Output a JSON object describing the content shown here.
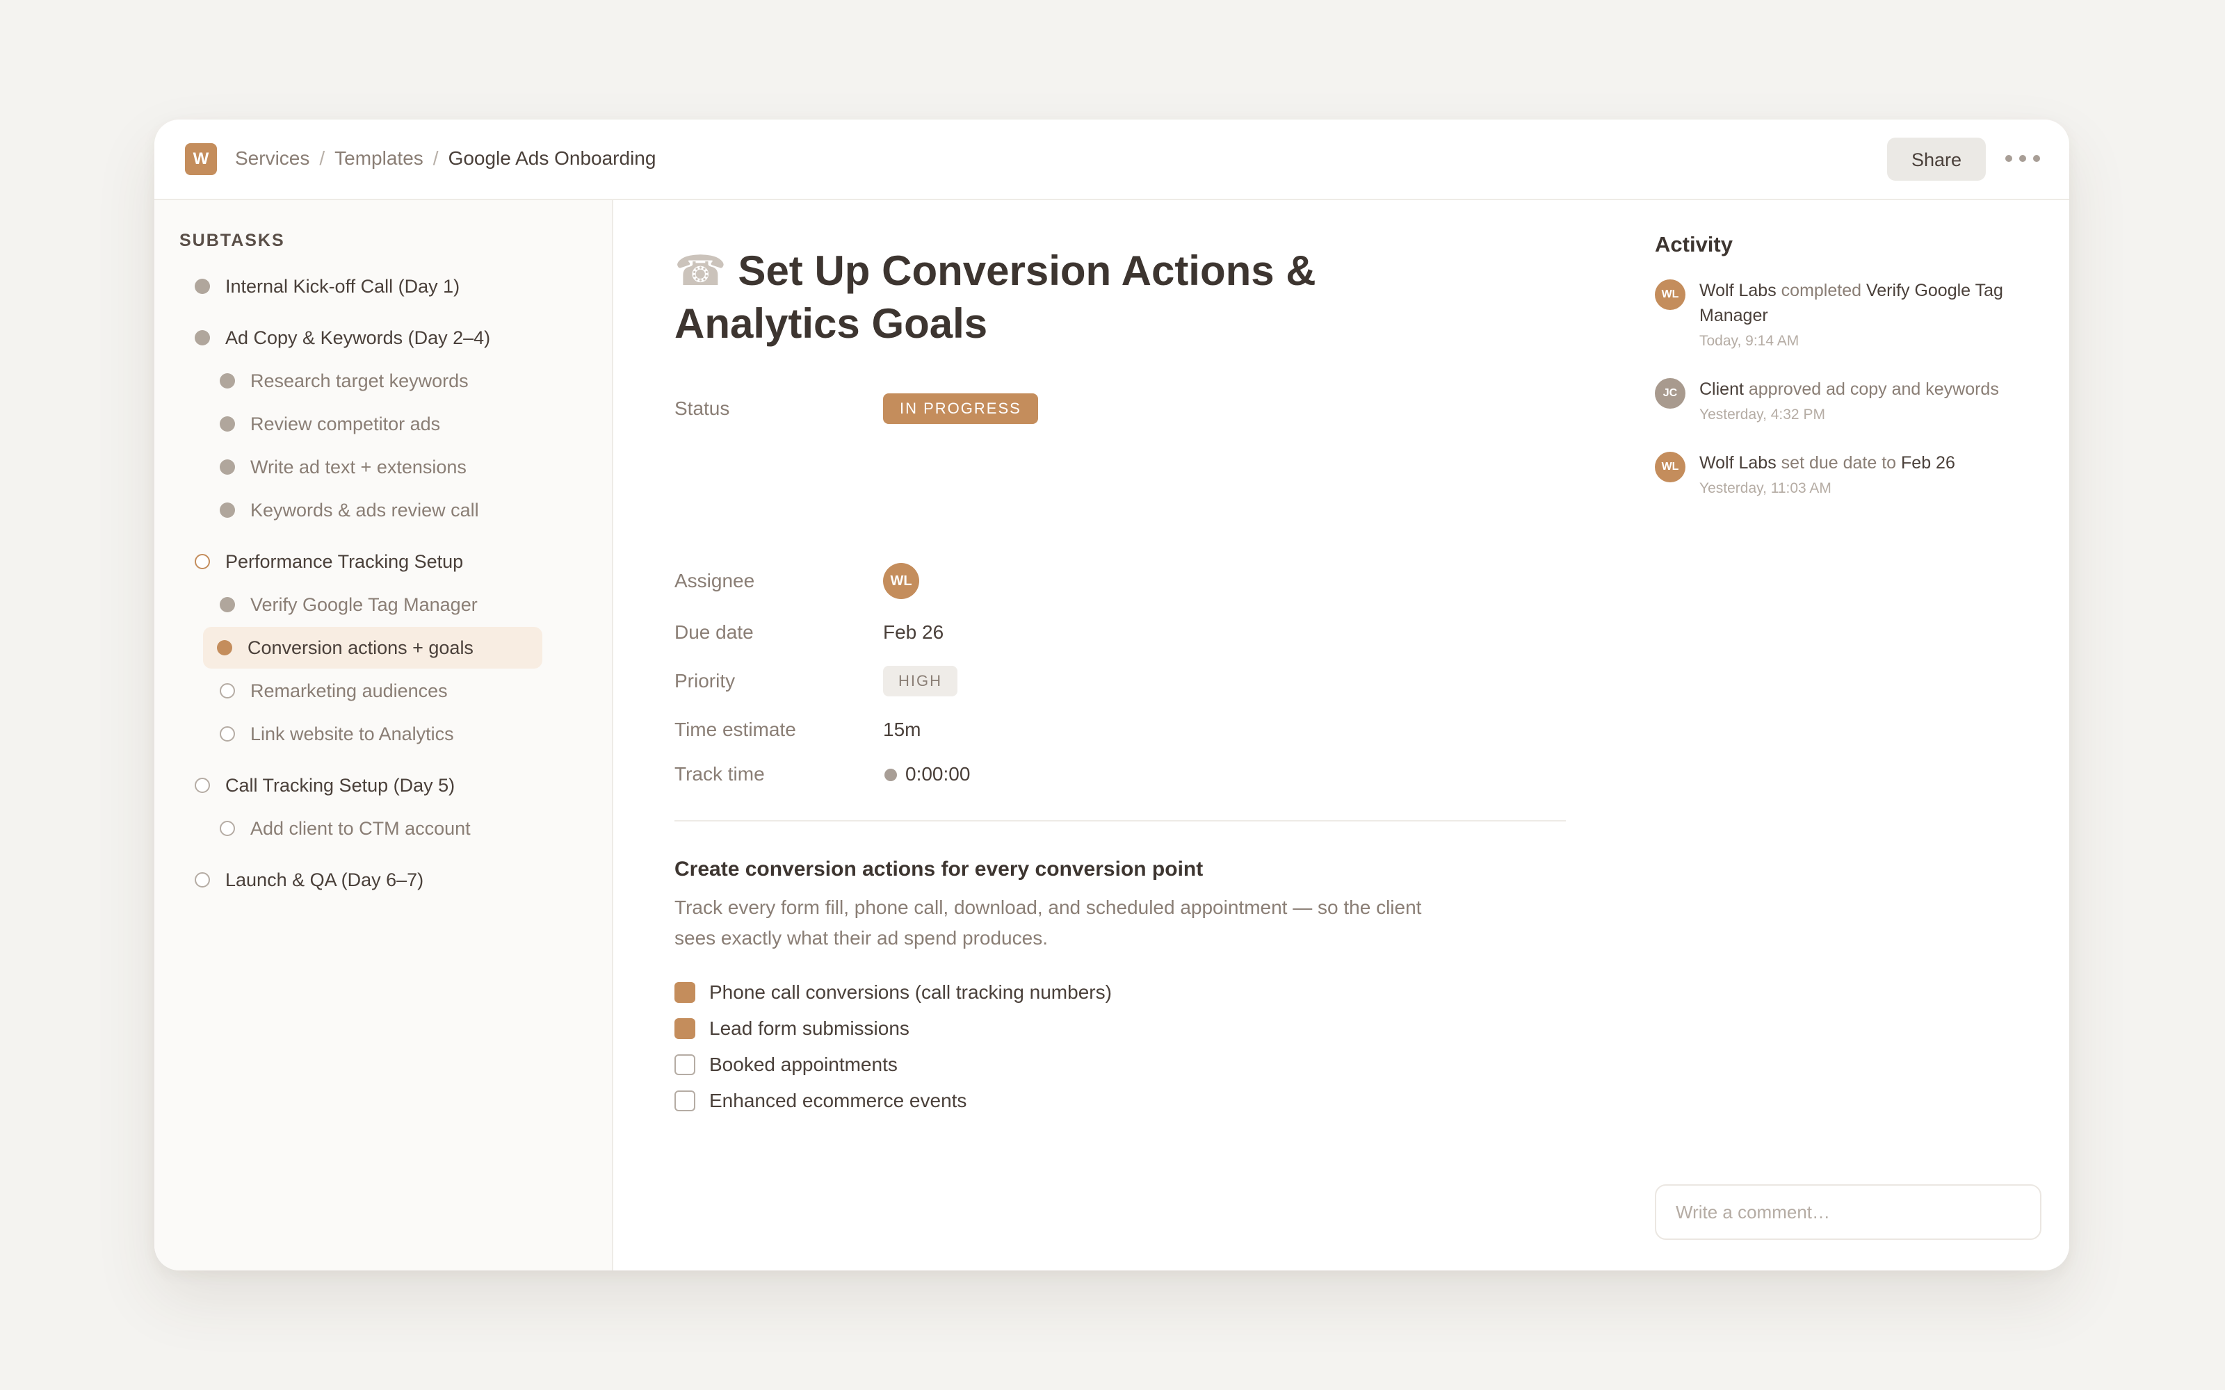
{
  "header": {
    "logo_letter": "W",
    "breadcrumb": [
      "Services",
      "Templates",
      "Google Ads Onboarding"
    ],
    "share_label": "Share",
    "more_icon": "more-horizontal-icon"
  },
  "sidebar": {
    "heading": "SUBTASKS",
    "items": [
      {
        "label": "Internal Kick-off Call (Day 1)",
        "level": 0,
        "state": "done"
      },
      {
        "label": "Ad Copy & Keywords (Day 2–4)",
        "level": 0,
        "state": "done"
      },
      {
        "label": "Research target keywords",
        "level": 1,
        "state": "done"
      },
      {
        "label": "Review competitor ads",
        "level": 1,
        "state": "done"
      },
      {
        "label": "Write ad text + extensions",
        "level": 1,
        "state": "done"
      },
      {
        "label": "Keywords & ads review call",
        "level": 1,
        "state": "done"
      },
      {
        "label": "Performance Tracking Setup",
        "level": 0,
        "state": "in-progress"
      },
      {
        "label": "Verify Google Tag Manager",
        "level": 1,
        "state": "done"
      },
      {
        "label": "Conversion actions + goals",
        "level": 1,
        "state": "active"
      },
      {
        "label": "Remarketing audiences",
        "level": 1,
        "state": "todo"
      },
      {
        "label": "Link website to Analytics",
        "level": 1,
        "state": "todo"
      },
      {
        "label": "Call Tracking Setup (Day 5)",
        "level": 0,
        "state": "todo"
      },
      {
        "label": "Add client to CTM account",
        "level": 1,
        "state": "todo"
      },
      {
        "label": "Launch & QA (Day 6–7)",
        "level": 0,
        "state": "todo"
      }
    ]
  },
  "task": {
    "title_icon": "☎",
    "title": "Set Up Conversion Actions & Analytics Goals",
    "fields": {
      "status_label": "Status",
      "status_value": "IN PROGRESS",
      "assignee_label": "Assignee",
      "assignee_initials": "WL",
      "due_label": "Due date",
      "due_value": "Feb 26",
      "priority_label": "Priority",
      "priority_value": "HIGH",
      "estimate_label": "Time estimate",
      "estimate_value": "15m",
      "track_label": "Track time",
      "track_value": "0:00:00"
    },
    "section_title": "Create conversion actions for every conversion point",
    "section_desc": "Track every form fill, phone call, download, and scheduled appointment — so the client sees exactly what their ad spend produces.",
    "checklist": [
      {
        "label": "Phone call conversions (call tracking numbers)",
        "checked": true
      },
      {
        "label": "Lead form submissions",
        "checked": true
      },
      {
        "label": "Booked appointments",
        "checked": false
      },
      {
        "label": "Enhanced ecommerce events",
        "checked": false
      }
    ]
  },
  "activity": {
    "heading": "Activity",
    "entries": [
      {
        "initials": "WL",
        "actor": "Wolf Labs",
        "action": "completed",
        "object": "Verify Google Tag Manager",
        "time": "Today, 9:14 AM",
        "color": "#c48d5c"
      },
      {
        "initials": "JC",
        "actor": "Client",
        "action": "approved ad copy and keywords",
        "object": "",
        "time": "Yesterday, 4:32 PM",
        "color": "#a89a8e"
      },
      {
        "initials": "WL",
        "actor": "Wolf Labs",
        "action": "set due date to",
        "object": "Feb 26",
        "time": "Yesterday, 11:03 AM",
        "color": "#c48d5c"
      }
    ],
    "comment_placeholder": "Write a comment…"
  },
  "colors": {
    "accent": "#c48d5c",
    "background": "#f4f3f0",
    "selected_row": "#f8ede2"
  }
}
